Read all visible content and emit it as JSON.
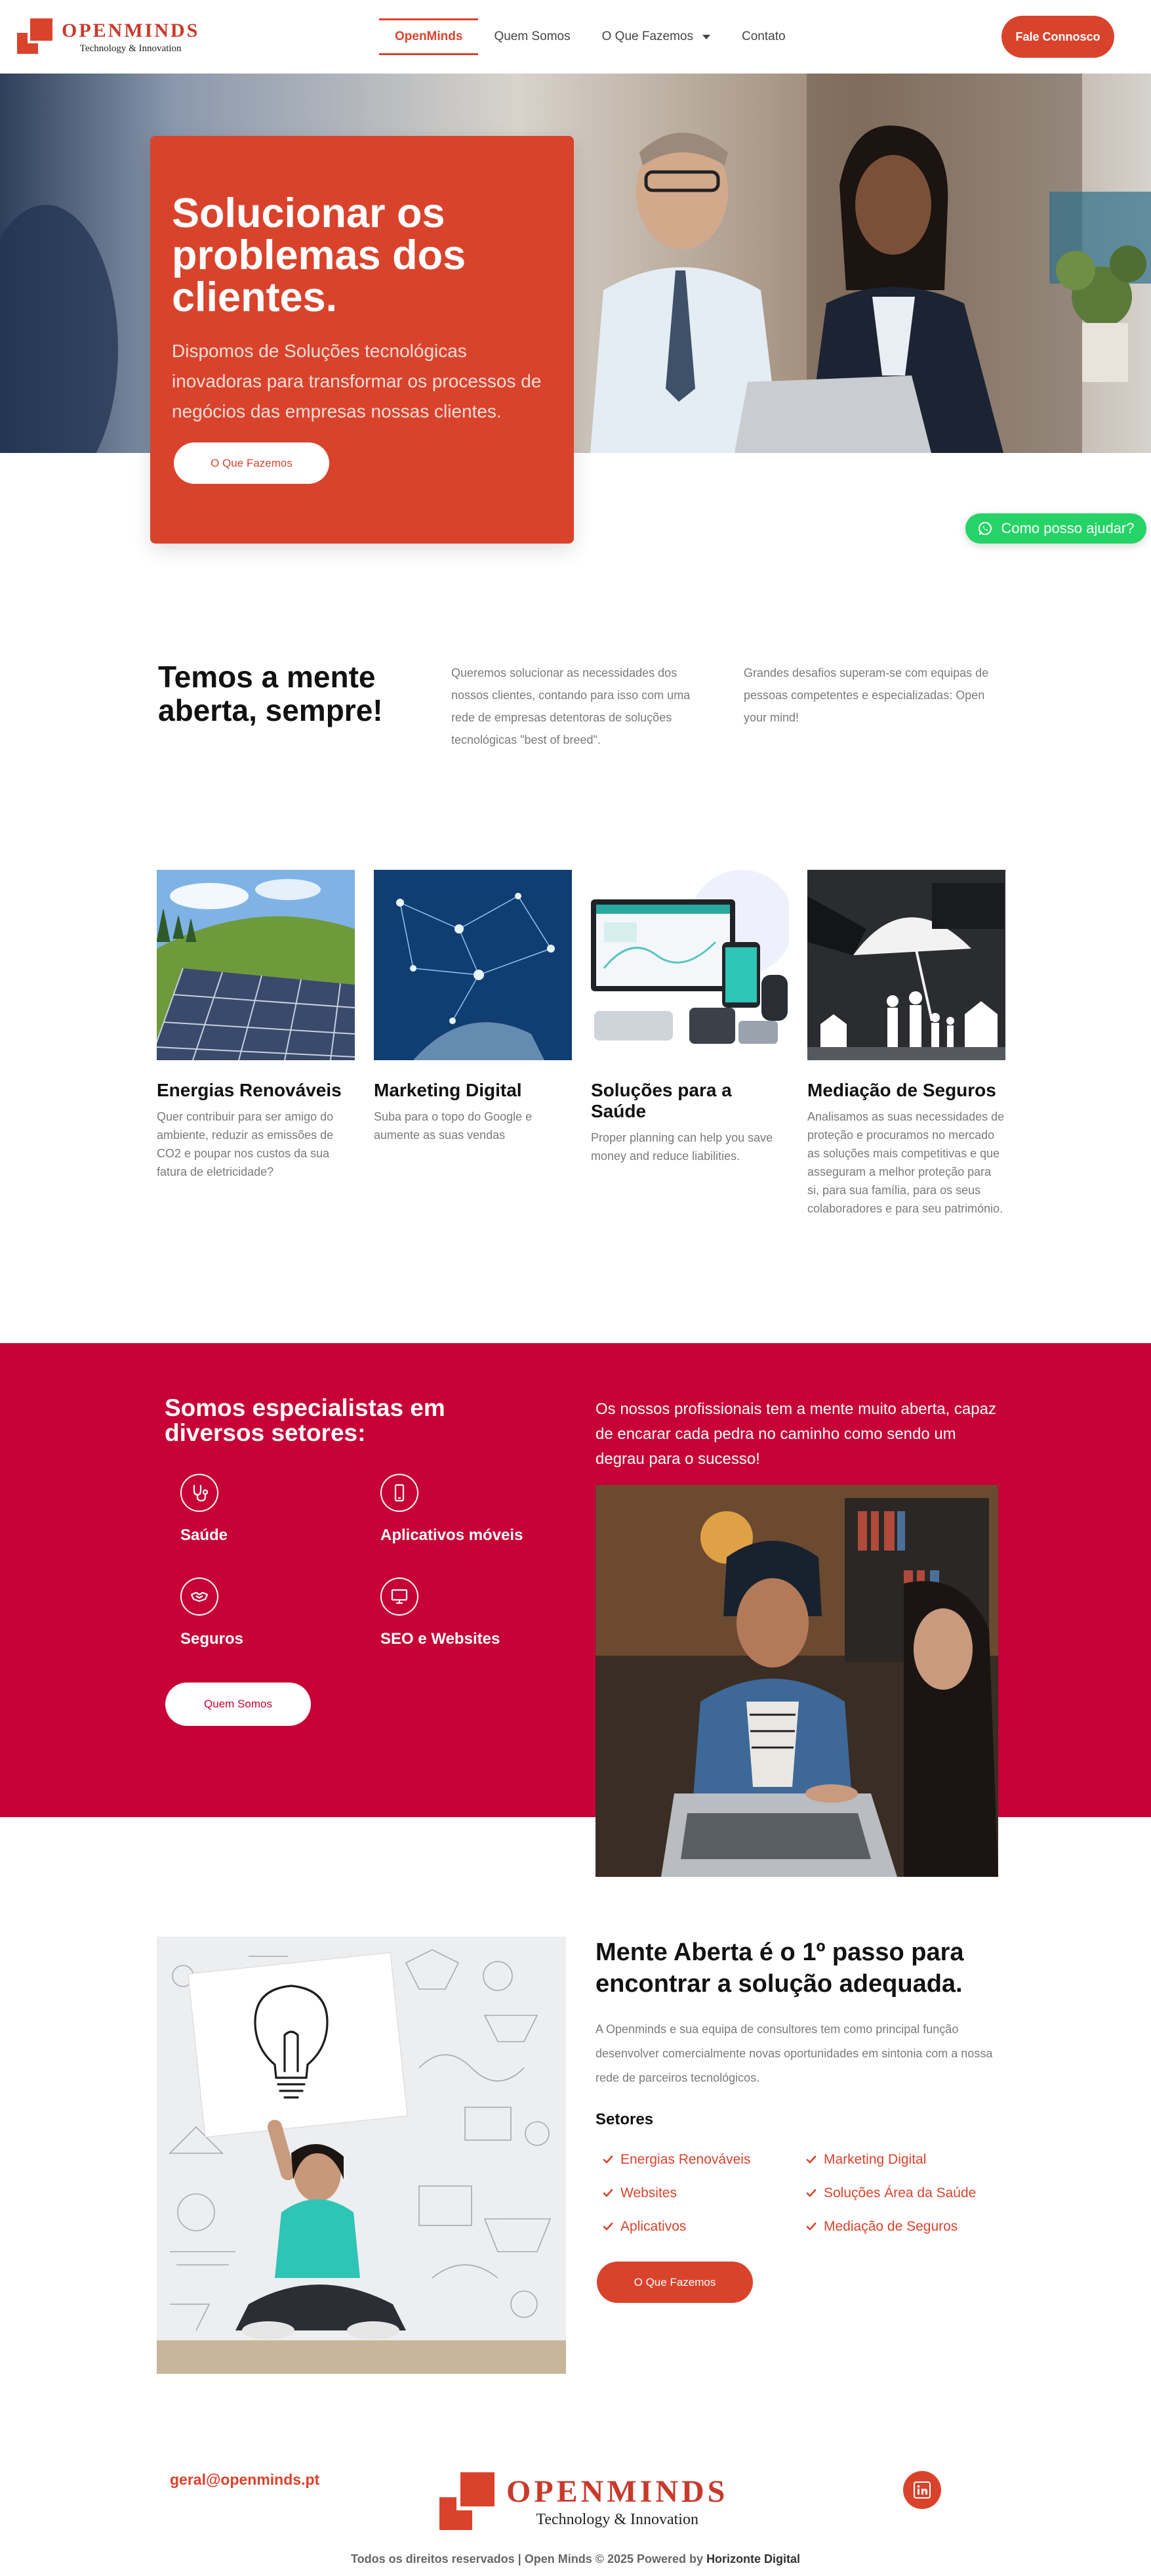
{
  "brand": {
    "name": "OPENMINDS",
    "tagline": "Technology & Innovation",
    "accent_color": "#d9432c",
    "sector_bg_color": "#c70036"
  },
  "nav": {
    "items": [
      {
        "label": "OpenMinds",
        "active": true
      },
      {
        "label": "Quem Somos"
      },
      {
        "label": "O Que Fazemos",
        "has_dropdown": true
      },
      {
        "label": "Contato"
      }
    ],
    "cta_label": "Fale Connosco"
  },
  "hero": {
    "title": "Solucionar os problemas dos clientes.",
    "text": "Dispomos de Soluções tecnológicas inovadoras para transformar os processos de negócios das empresas nossas clientes.",
    "button_label": "O Que Fazemos"
  },
  "whatsapp": {
    "label": "Como posso ajudar?",
    "icon": "whatsapp-icon"
  },
  "about": {
    "title": "Temos a mente aberta, sempre!",
    "col1": "Queremos solucionar as necessidades dos nossos clientes, contando para isso com uma rede de empresas detentoras de soluções tecnológicas \"best of breed\".",
    "col2": "Grandes desafios superam-se com equipas de pessoas competentes e especializadas: Open your mind!"
  },
  "services": [
    {
      "title": "Energias Renováveis",
      "desc": "Quer contribuir para ser amigo do ambiente, reduzir as emissões de CO2 e poupar nos custos da sua fatura de eletricidade?",
      "image": "solar-panels"
    },
    {
      "title": "Marketing Digital",
      "desc": "Suba para o topo do Google e aumente as suas vendas",
      "image": "digital-network"
    },
    {
      "title": "Soluções para a Saúde",
      "desc": "Proper planning can help you save money and reduce liabilities.",
      "image": "health-devices"
    },
    {
      "title": "Mediação de Seguros",
      "desc": "Analisamos as suas necessidades de proteção e procuramos no mercado as soluções mais competitivas e que asseguram a melhor proteção para si, para sua família, para os seus colaboradores e para seu património.",
      "image": "insurance-umbrella"
    }
  ],
  "specialists": {
    "title": "Somos especialistas em diversos setores:",
    "items": [
      {
        "label": "Saúde",
        "icon": "stethoscope-icon"
      },
      {
        "label": "Aplicativos móveis",
        "icon": "mobile-icon"
      },
      {
        "label": "Seguros",
        "icon": "handshake-icon"
      },
      {
        "label": "SEO e Websites",
        "icon": "desktop-icon"
      }
    ],
    "button_label": "Quem Somos",
    "text": "Os nossos profissionais tem a mente muito aberta, capaz de encarar cada pedra no caminho como sendo um degrau para o sucesso!"
  },
  "mind": {
    "title": "Mente Aberta é o 1º passo para encontrar a solução adequada.",
    "text": "A Openminds e sua equipa de consultores tem como principal função desenvolver comercialmente novas oportunidades em sintonia com a nossa rede de parceiros tecnológicos.",
    "setores_title": "Setores",
    "setores": [
      "Energias Renováveis",
      "Marketing Digital",
      "Websites",
      "Soluções Área da Saúde",
      "Aplicativos",
      "Mediação de Seguros"
    ],
    "button_label": "O Que Fazemos"
  },
  "footer": {
    "email": "geral@openminds.pt",
    "social_icon": "linkedin-icon",
    "copyright_prefix": "Todos os direitos reservados | Open Minds © 2025 Powered by ",
    "copyright_brand": "Horizonte Digital"
  }
}
